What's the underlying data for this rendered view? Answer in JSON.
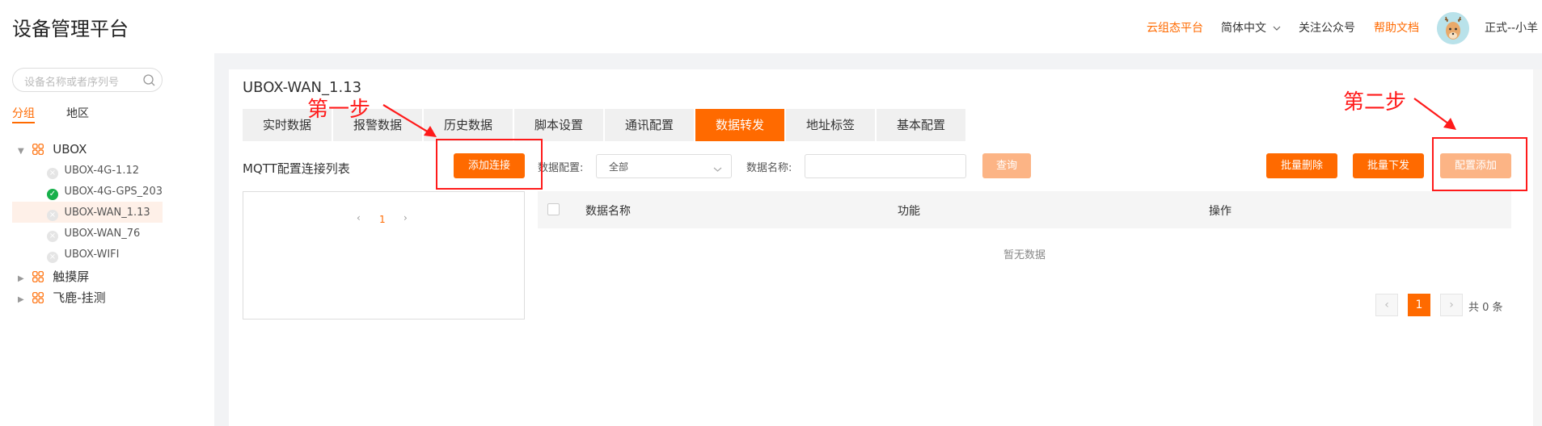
{
  "header": {
    "app_title": "设备管理平台",
    "links": [
      {
        "label": "云组态平台",
        "highlight": true
      },
      {
        "label": "简体中文",
        "highlight": false
      },
      {
        "label": "关注公众号",
        "highlight": false
      },
      {
        "label": "帮助文档",
        "highlight": true
      }
    ],
    "language_dropdown_icon": "chevron-down-icon",
    "user_name": "正式--小羊"
  },
  "sidebar": {
    "search_placeholder": "设备名称或者序列号",
    "tabs": [
      {
        "label": "分组",
        "active": true
      },
      {
        "label": "地区",
        "active": false
      }
    ],
    "tree": [
      {
        "label": "UBOX",
        "type": "group",
        "expanded": true
      },
      {
        "label": "UBOX-4G-1.12",
        "type": "device",
        "status": "offline"
      },
      {
        "label": "UBOX-4G-GPS_203",
        "type": "device",
        "status": "online"
      },
      {
        "label": "UBOX-WAN_1.13",
        "type": "device",
        "status": "offline",
        "selected": true
      },
      {
        "label": "UBOX-WAN_76",
        "type": "device",
        "status": "offline"
      },
      {
        "label": "UBOX-WIFI",
        "type": "device",
        "status": "offline"
      },
      {
        "label": "触摸屏",
        "type": "group",
        "expanded": false
      },
      {
        "label": "飞鹿-挂测",
        "type": "group",
        "expanded": false
      }
    ]
  },
  "main": {
    "device_title": "UBOX-WAN_1.13",
    "tabs": [
      {
        "label": "实时数据",
        "active": false
      },
      {
        "label": "报警数据",
        "active": false
      },
      {
        "label": "历史数据",
        "active": false
      },
      {
        "label": "脚本设置",
        "active": false
      },
      {
        "label": "通讯配置",
        "active": false
      },
      {
        "label": "数据转发",
        "active": true
      },
      {
        "label": "地址标签",
        "active": false
      },
      {
        "label": "基本配置",
        "active": false
      }
    ],
    "left_title": "MQTT配置连接列表",
    "add_connection_label": "添加连接",
    "left_pager_current": "1",
    "filter": {
      "config_label": "数据配置:",
      "config_value": "全部",
      "name_label": "数据名称:",
      "name_value": "",
      "query_label": "查询"
    },
    "actions": {
      "batch_delete": "批量删除",
      "batch_send": "批量下发",
      "config_add": "配置添加"
    },
    "table": {
      "columns": [
        "数据名称",
        "功能",
        "操作"
      ],
      "rows": [],
      "empty_text": "暂无数据"
    },
    "pager": {
      "current": "1",
      "total_text": "共 0 条"
    }
  },
  "annotations": {
    "step1": "第一步",
    "step2": "第二步"
  },
  "colors": {
    "accent": "#ff6a00",
    "accent_light": "#fcb485",
    "annotation": "#ff1a1a",
    "online": "#16b04a"
  }
}
